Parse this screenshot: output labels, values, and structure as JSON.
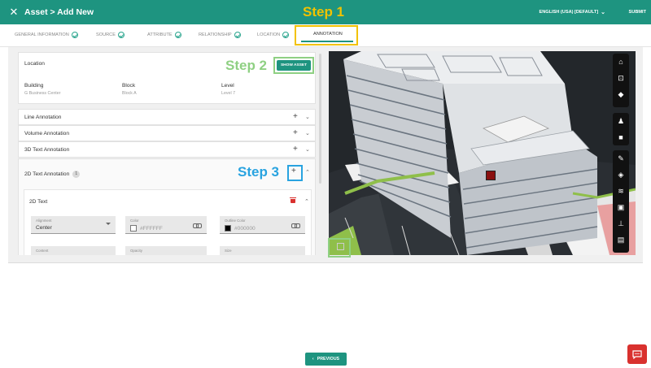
{
  "header": {
    "close_icon": "close-icon",
    "title": "Asset > Add New",
    "language": "ENGLISH (USA) [DEFAULT]",
    "submit": "SUBMIT",
    "color": "#1e9480"
  },
  "annotations": {
    "step1": "Step 1",
    "step2": "Step 2",
    "step3": "Step 3",
    "step1_color": "#f2c200",
    "step2_color": "#8fd083",
    "step3_color": "#29a3e0"
  },
  "tabs": [
    {
      "label": "GENERAL INFORMATION",
      "completed": true
    },
    {
      "label": "SOURCE",
      "completed": true
    },
    {
      "label": "ATTRIBUTE",
      "completed": true
    },
    {
      "label": "RELATIONSHIP",
      "completed": true
    },
    {
      "label": "LOCATION",
      "completed": true
    },
    {
      "label": "ANNOTATION",
      "completed": false,
      "active": true
    }
  ],
  "location": {
    "title": "Location",
    "show_asset": "SHOW ASSET",
    "fields": [
      {
        "label": "Building",
        "value": "G Business Center"
      },
      {
        "label": "Block",
        "value": "Block A"
      },
      {
        "label": "Level",
        "value": "Level 7"
      }
    ]
  },
  "sections": [
    {
      "label": "Line Annotation"
    },
    {
      "label": "Volume Annotation"
    },
    {
      "label": "3D Text Annotation"
    }
  ],
  "text2d": {
    "label": "2D Text Annotation",
    "count": "1",
    "item": {
      "title": "2D Text",
      "alignment_label": "Alignment",
      "alignment_value": "Center",
      "color_label": "Color",
      "color_value": "#FFFFFF",
      "outline_label": "Outline Color",
      "outline_value": "#000000",
      "content_label": "Content",
      "opacity_label": "Opacity",
      "size_label": "Size"
    }
  },
  "viewer": {
    "toolbar_top": [
      "home-icon",
      "focus-icon",
      "fill-icon"
    ],
    "toolbar_mid": [
      "walk-person-icon",
      "camera-icon"
    ],
    "toolbar_bottom": [
      "pencil-icon",
      "layers-edit-icon",
      "layers-icon",
      "box-icon",
      "hierarchy-icon",
      "document-icon"
    ]
  },
  "footer": {
    "previous": "PREVIOUS"
  }
}
